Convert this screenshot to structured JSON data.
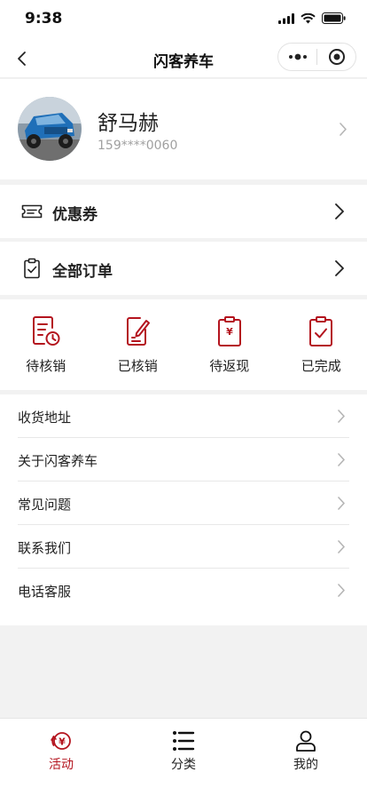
{
  "status_bar": {
    "time": "9:38"
  },
  "nav": {
    "title": "闪客养车",
    "icons": [
      "back-icon",
      "more-icon",
      "target-icon"
    ]
  },
  "profile": {
    "name": "舒马赫",
    "phone": "159****0060",
    "avatar": "blue jeep photo"
  },
  "coupon": {
    "label": "优惠券"
  },
  "all_orders": {
    "label": "全部订单"
  },
  "order_status": [
    {
      "label": "待核销",
      "icon": "pending-writeoff-icon"
    },
    {
      "label": "已核销",
      "icon": "written-off-icon"
    },
    {
      "label": "待返现",
      "icon": "pending-cashback-icon"
    },
    {
      "label": "已完成",
      "icon": "completed-icon"
    }
  ],
  "menu": [
    {
      "label": "收货地址"
    },
    {
      "label": "关于闪客养车"
    },
    {
      "label": "常见问题"
    },
    {
      "label": "联系我们"
    },
    {
      "label": "电话客服"
    }
  ],
  "tabbar": [
    {
      "label": "活动",
      "icon": "activity-icon",
      "active": true
    },
    {
      "label": "分类",
      "icon": "category-icon",
      "active": false
    },
    {
      "label": "我的",
      "icon": "profile-icon",
      "active": false
    }
  ],
  "colors": {
    "accent": "#b4141e",
    "background": "#f2f2f2"
  }
}
